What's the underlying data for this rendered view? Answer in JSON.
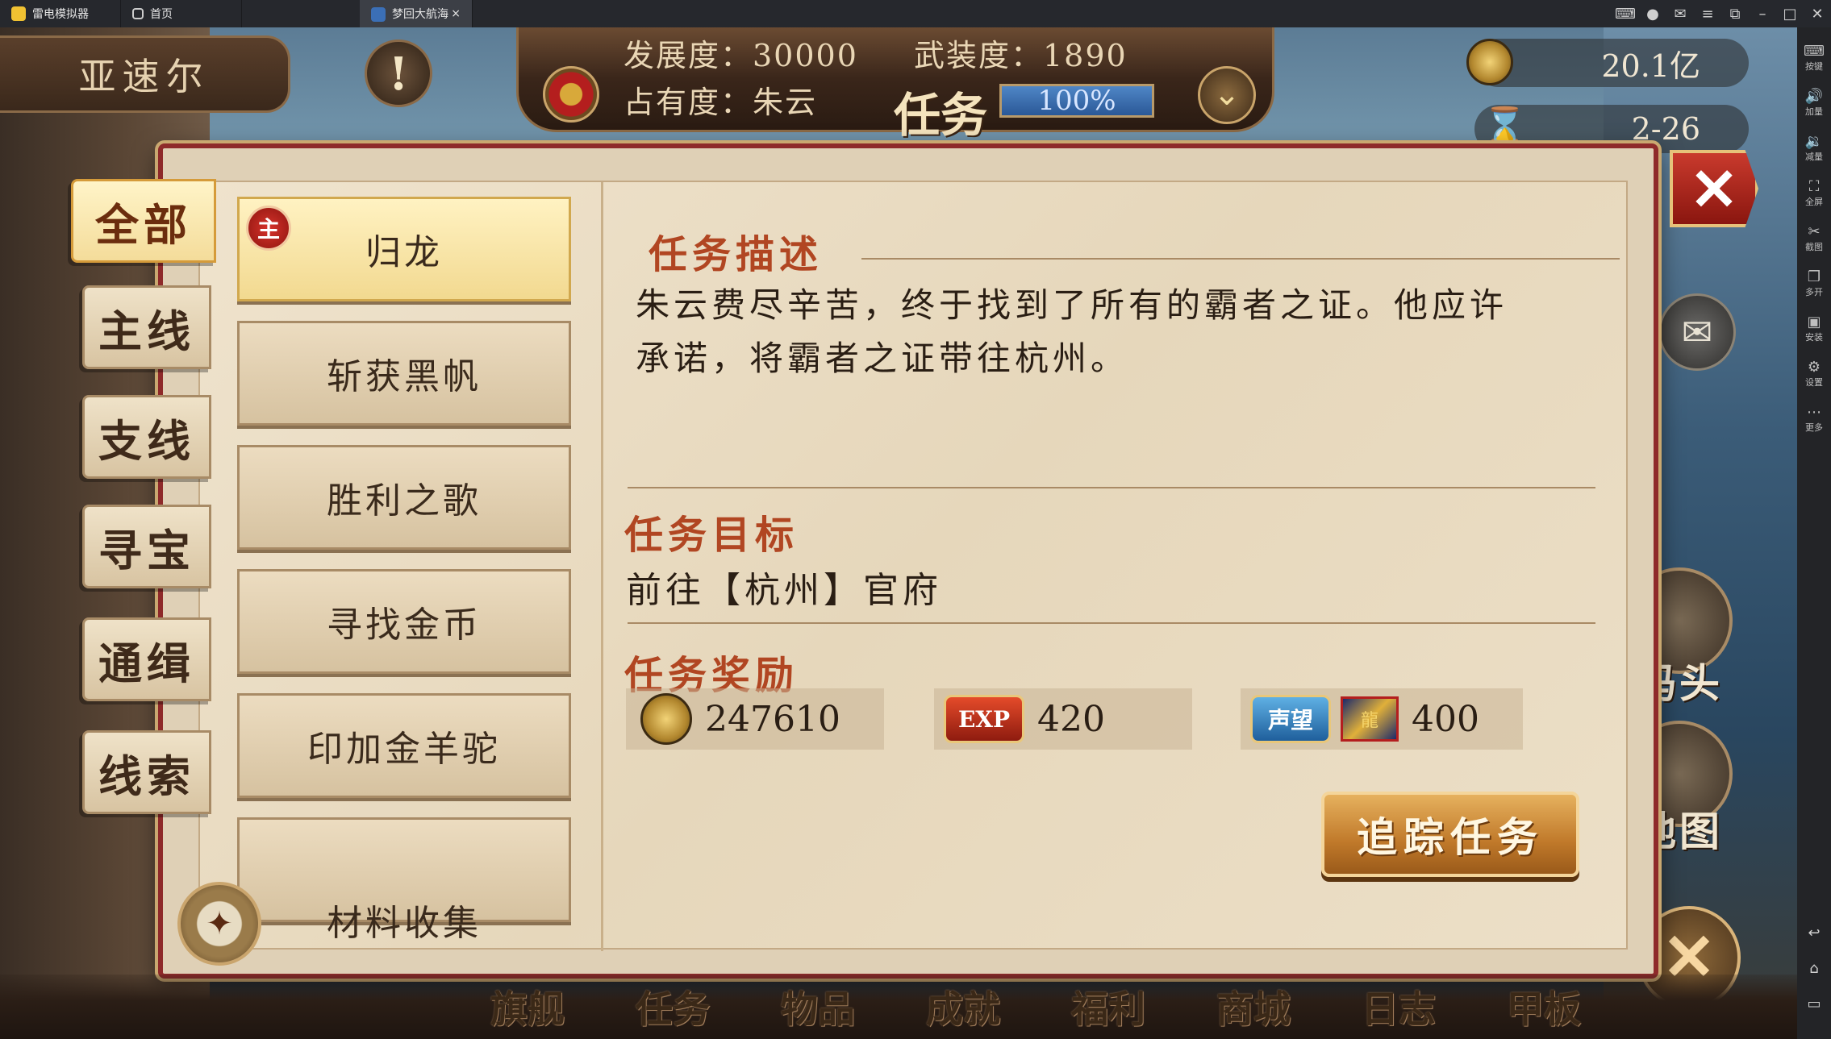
{
  "window": {
    "app_name": "雷电模拟器",
    "tabs": [
      {
        "label": "首页"
      },
      {
        "label": "梦回大航海"
      }
    ],
    "controls": [
      "gamepad-icon",
      "user-icon",
      "mail-icon",
      "menu-icon",
      "pin-icon",
      "minimize-icon",
      "maximize-icon",
      "close-icon"
    ]
  },
  "emulator_sidebar": {
    "items": [
      {
        "icon": "keyboard-icon",
        "label": "按键"
      },
      {
        "icon": "volume-up-icon",
        "label": "加量"
      },
      {
        "icon": "volume-down-icon",
        "label": "减量"
      },
      {
        "icon": "fullscreen-icon",
        "label": "全屏"
      },
      {
        "icon": "scissors-icon",
        "label": "截图"
      },
      {
        "icon": "multi-open-icon",
        "label": "多开"
      },
      {
        "icon": "apk-install-icon",
        "label": "安装"
      },
      {
        "icon": "gear-icon",
        "label": "设置"
      },
      {
        "icon": "more-icon",
        "label": "更多"
      }
    ]
  },
  "hud": {
    "city_name": "亚速尔",
    "development": "发展度：30000",
    "armament": "武装度：1890",
    "occupancy": "占有度：朱云",
    "task_label": "任务",
    "progress_value": 1.0,
    "progress_label": "100%",
    "gold": "20.1亿",
    "date": "2-26"
  },
  "panel": {
    "categories": [
      {
        "label": "全部",
        "selected": true
      },
      {
        "label": "主线"
      },
      {
        "label": "支线"
      },
      {
        "label": "寻宝"
      },
      {
        "label": "通缉"
      },
      {
        "label": "线索"
      }
    ],
    "quests": [
      {
        "label": "归龙",
        "badge": "主",
        "selected": true
      },
      {
        "label": "斩获黑帆"
      },
      {
        "label": "胜利之歌"
      },
      {
        "label": "寻找金币"
      },
      {
        "label": "印加金羊驼"
      },
      {
        "label": "材料收集"
      }
    ],
    "description_heading": "任务描述",
    "description": "朱云费尽辛苦，终于找到了所有的霸者之证。他应许承诺，将霸者之证带往杭州。",
    "goal_heading": "任务目标",
    "goal": "前往【杭州】官府",
    "reward_heading": "任务奖励",
    "rewards": [
      {
        "icon": "gold-coin-icon",
        "value": "247610"
      },
      {
        "icon": "exp-icon",
        "icon_text": "EXP",
        "value": "420"
      },
      {
        "icon": "reputation-icon",
        "icon_text": "声望",
        "value": "400"
      }
    ],
    "track_button": "追踪任务"
  },
  "right_menu": {
    "dock": "码头",
    "map": "地图"
  },
  "bottom_nav": [
    "旗舰",
    "任务",
    "物品",
    "成就",
    "福利",
    "商城",
    "日志",
    "甲板"
  ]
}
